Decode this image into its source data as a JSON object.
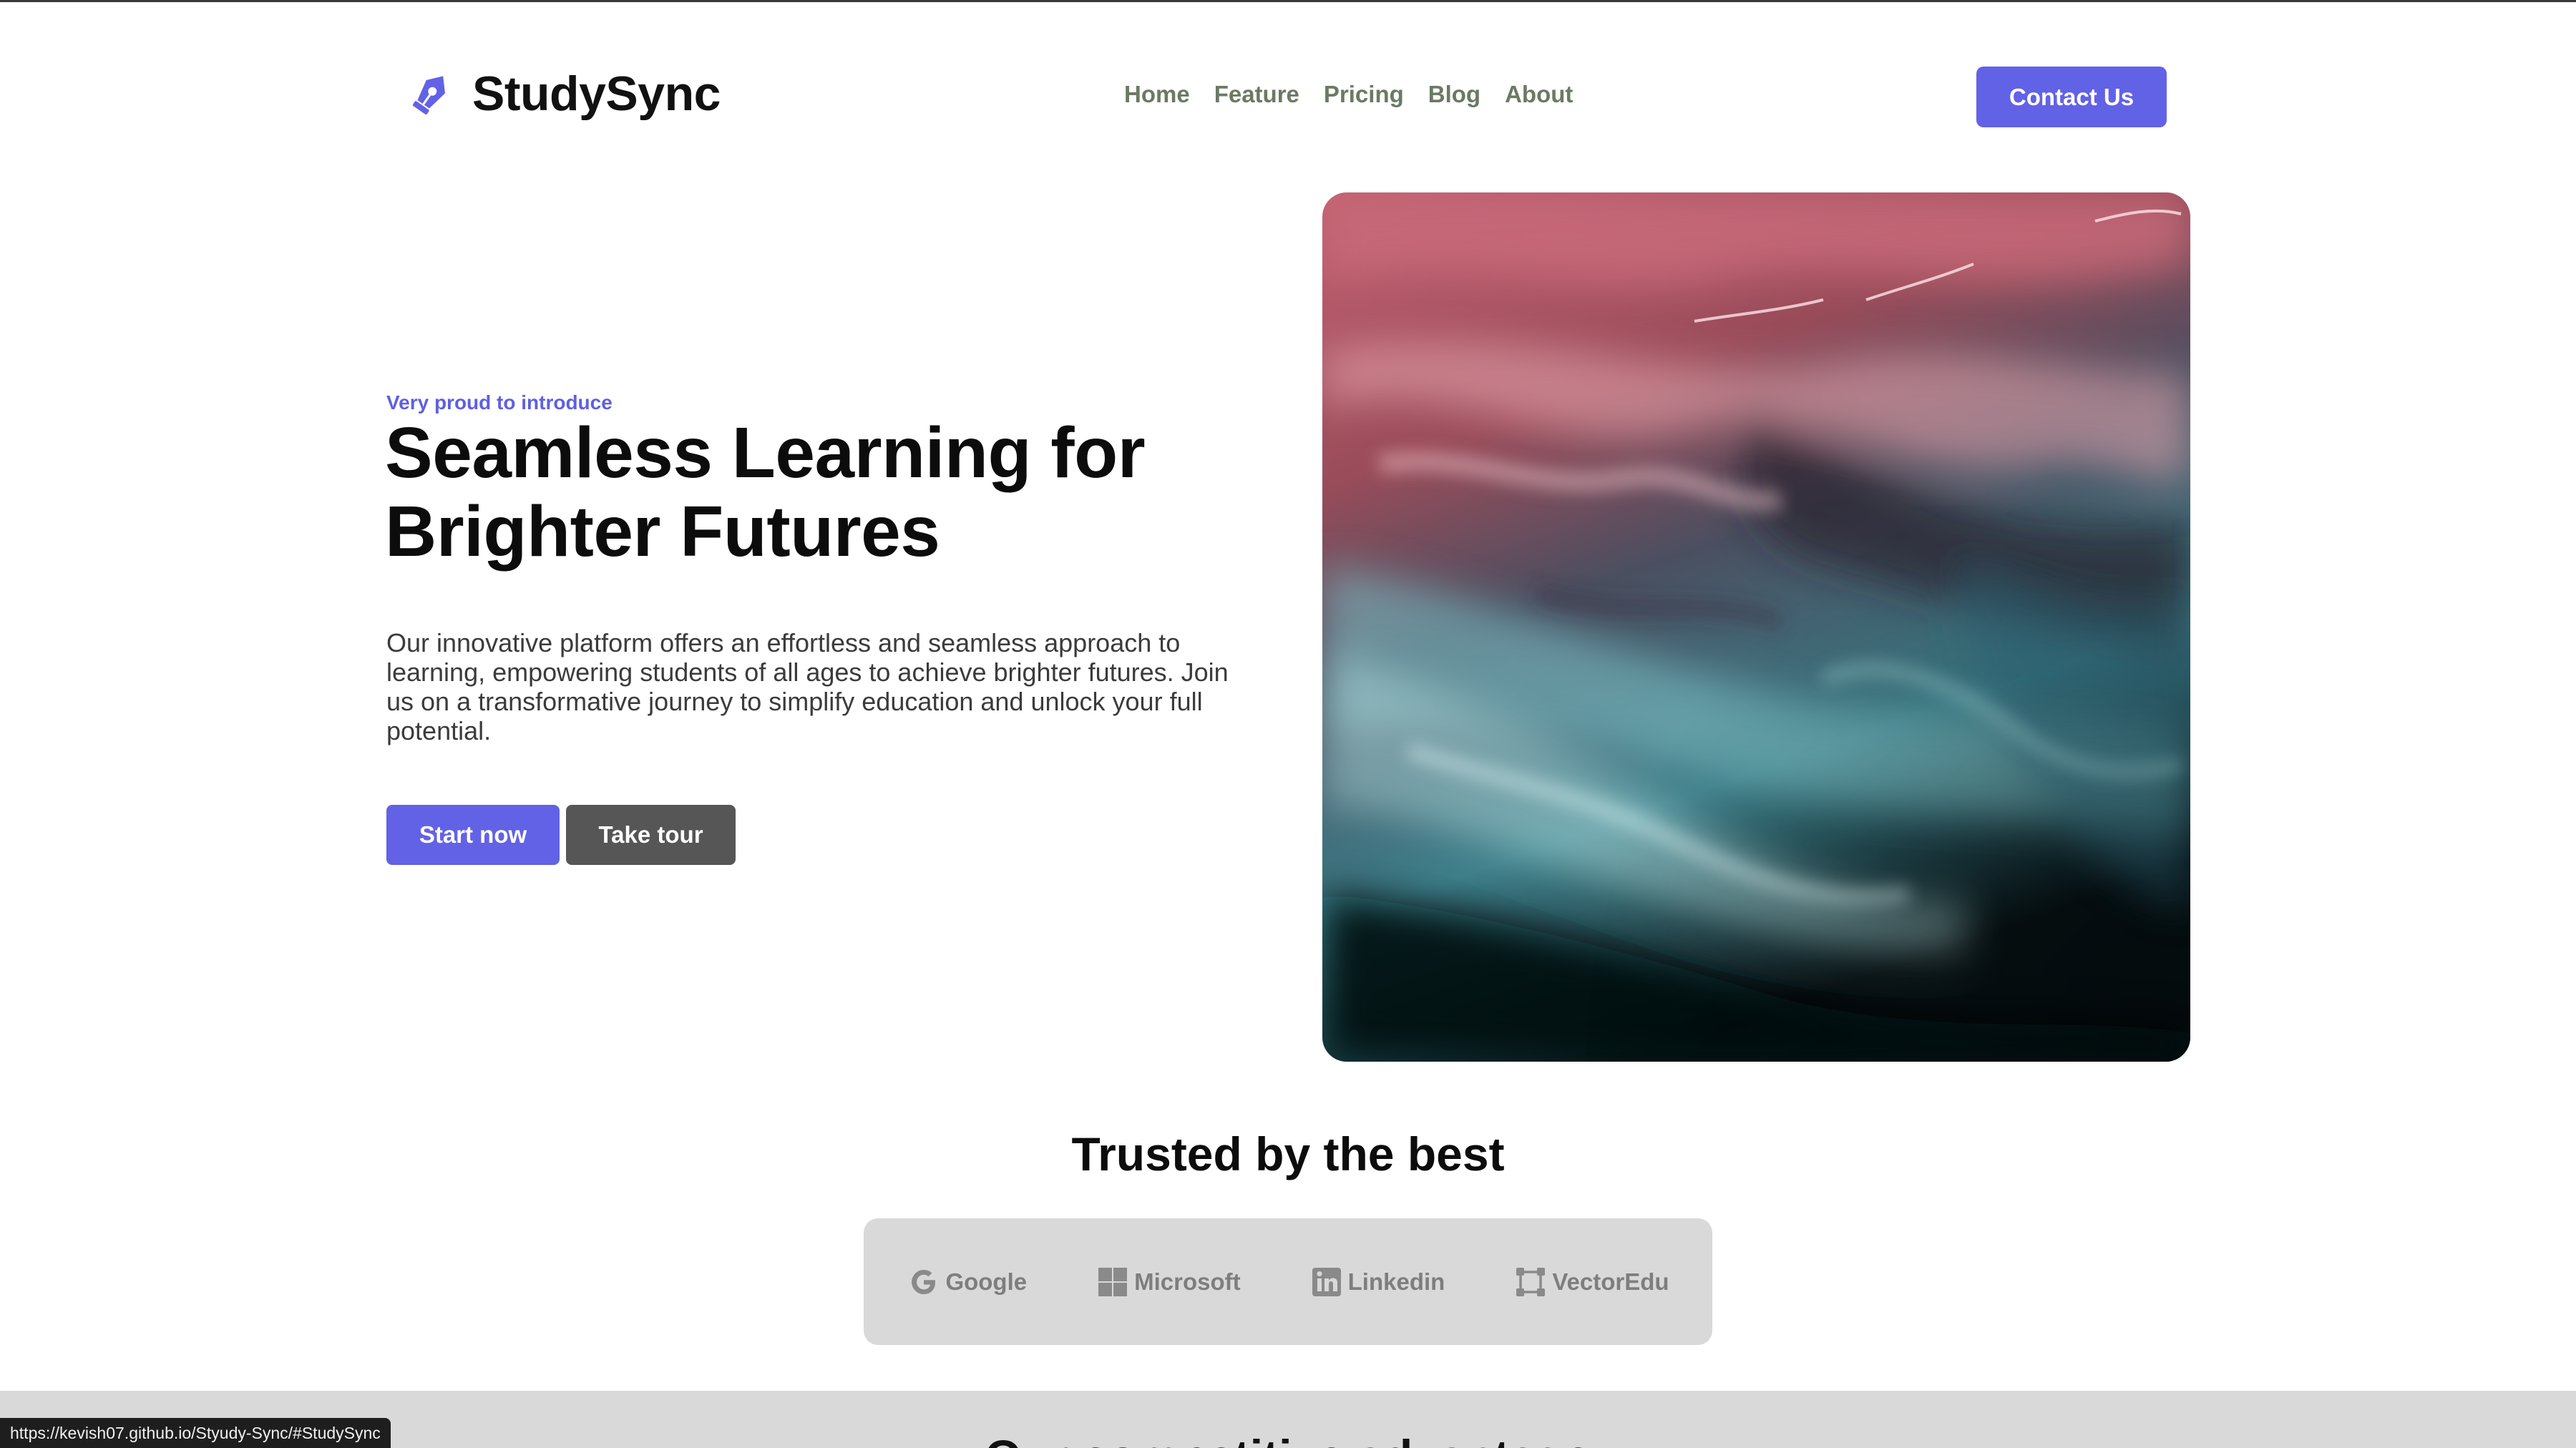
{
  "brand": {
    "name": "StudySync",
    "accent": "#6262e6",
    "icon": "pen-nib-icon"
  },
  "nav": {
    "items": [
      "Home",
      "Feature",
      "Pricing",
      "Blog",
      "About"
    ]
  },
  "header": {
    "contact_label": "Contact Us"
  },
  "hero": {
    "eyebrow": "Very proud to introduce",
    "title_line1": "Seamless Learning for",
    "title_line2": "Brighter Futures",
    "description": "Our innovative platform offers an effortless and seamless approach to learning, empowering students of all ages to achieve brighter futures. Join us on a transformative journey to simplify education and unlock your full potential.",
    "start_label": "Start now",
    "tour_label": "Take tour"
  },
  "trusted": {
    "title": "Trusted by the best",
    "logos": [
      {
        "name": "Google",
        "icon": "google-icon"
      },
      {
        "name": "Microsoft",
        "icon": "microsoft-icon"
      },
      {
        "name": "Linkedin",
        "icon": "linkedin-icon"
      },
      {
        "name": "VectorEdu",
        "icon": "vector-edu-icon"
      }
    ]
  },
  "next_section": {
    "title": "Our competitive advantage"
  },
  "status_bar": {
    "url": "https://kevish07.github.io/Styudy-Sync/#StudySync"
  }
}
